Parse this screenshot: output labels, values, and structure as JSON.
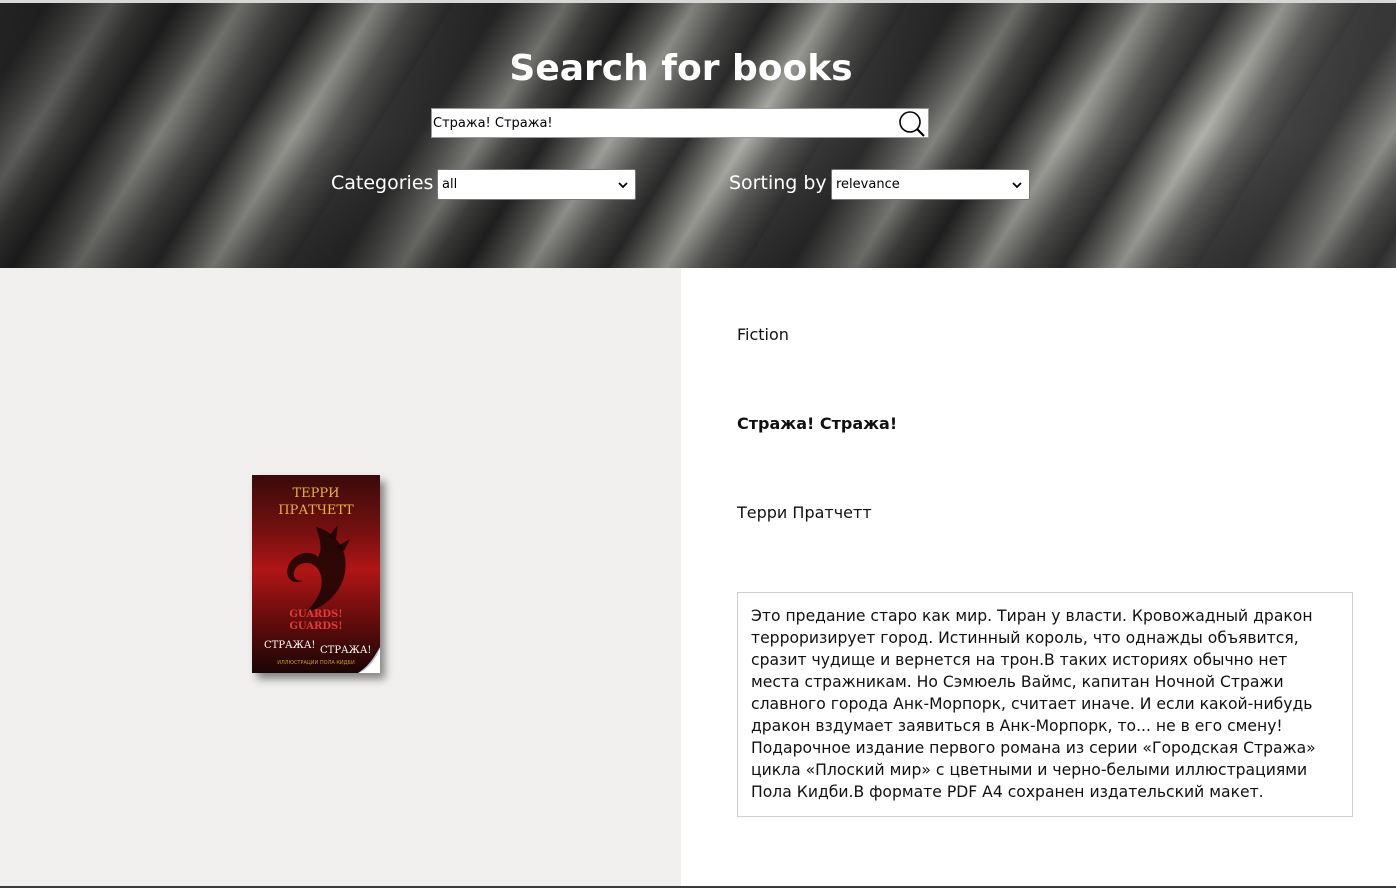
{
  "header": {
    "title": "Search for books",
    "search": {
      "value": "Стража! Стража!",
      "icon": "search-icon"
    },
    "categories": {
      "label": "Categories",
      "selected": "all"
    },
    "sorting": {
      "label": "Sorting by",
      "selected": "relevance"
    }
  },
  "book": {
    "cover": {
      "author": "ТЕРРИ ПРАТЧЕТТ",
      "title_en": "GUARDS! GUARDS!",
      "title_ru_1": "СТРАЖА!",
      "title_ru_2": "СТРАЖА!",
      "illustrator": "ИЛЛЮСТРАЦИИ ПОЛА КИДБИ"
    },
    "category": "Fiction",
    "title": "Стража! Стража!",
    "author": "Терри Пратчетт",
    "description": "Это предание старо как мир. Тиран у власти. Кровожадный дракон терроризирует город. Истинный король, что однажды объявится, сразит чудище и вернется на трон.В таких историях обычно нет места стражникам. Но Сэмюель Ваймс, капитан Ночной Стражи славного города Анк-Морпорк, считает иначе. И если какой-нибудь дракон вздумает заявиться в Анк-Морпорк, то... не в его смену!Подарочное издание первого романа из серии «Городская Стража» цикла «Плоский мир» с цветными и черно-белыми иллюстрациями Пола Кидби.В формате PDF A4 сохранен издательский макет."
  }
}
